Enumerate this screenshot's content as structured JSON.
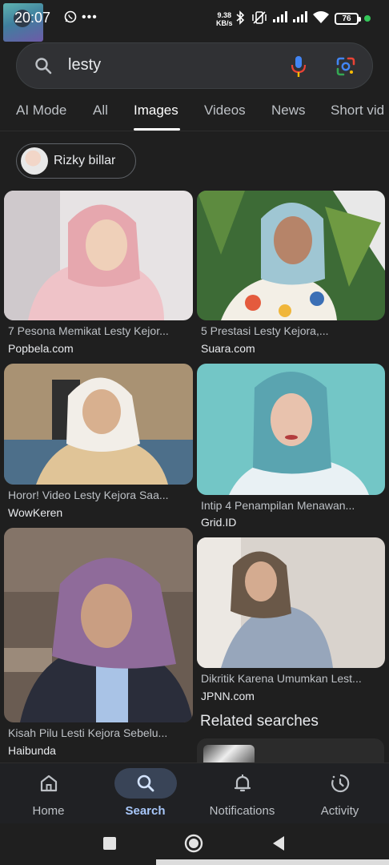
{
  "status_bar": {
    "time": "20:07",
    "net_speed_value": "9.38",
    "net_speed_unit": "KB/s",
    "battery": "76"
  },
  "search": {
    "query": "lesty"
  },
  "tabs": [
    {
      "label": "AI Mode"
    },
    {
      "label": "All"
    },
    {
      "label": "Images"
    },
    {
      "label": "Videos"
    },
    {
      "label": "News"
    },
    {
      "label": "Short vid"
    }
  ],
  "active_tab": "Images",
  "chip": {
    "label": "Rizky billar"
  },
  "results": [
    {
      "caption": "7 Pesona Memikat Lesty Kejor...",
      "source": "Popbela.com"
    },
    {
      "caption": "5 Prestasi Lesty Kejora,...",
      "source": "Suara.com"
    },
    {
      "caption": "Horor! Video Lesty Kejora Saa...",
      "source": "WowKeren"
    },
    {
      "caption": "Intip 4 Penampilan Menawan...",
      "source": "Grid.ID"
    },
    {
      "caption": "Kisah Pilu Lesti Kejora Sebelu...",
      "source": "Haibunda"
    },
    {
      "caption": "Dikritik Karena Umumkan Lest...",
      "source": "JPNN.com"
    }
  ],
  "related": {
    "title": "Related searches"
  },
  "bottom_nav": [
    {
      "label": "Home",
      "icon": "home-icon"
    },
    {
      "label": "Search",
      "icon": "search-icon"
    },
    {
      "label": "Notifications",
      "icon": "bell-icon"
    },
    {
      "label": "Activity",
      "icon": "history-icon"
    }
  ],
  "active_nav": "Search",
  "colors": {
    "background": "#1f1f1f",
    "accent": "#a8c7fa",
    "nav_pill": "#394457"
  }
}
